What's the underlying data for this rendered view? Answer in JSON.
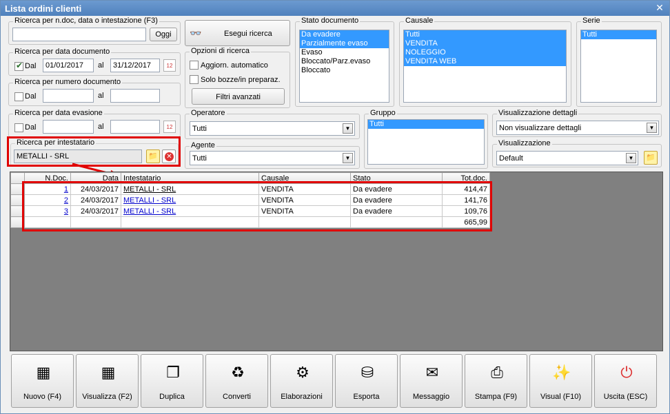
{
  "title": "Lista ordini clienti",
  "search_doc": {
    "label": "Ricerca per n.doc, data o intestazione (F3)",
    "value": "",
    "oggi": "Oggi"
  },
  "esegui": "Esegui ricerca",
  "data_doc": {
    "label": "Ricerca per data documento",
    "dal": "Dal",
    "from": "01/01/2017",
    "al": "al",
    "to": "31/12/2017",
    "checked": true
  },
  "num_doc": {
    "label": "Ricerca per numero documento",
    "dal": "Dal",
    "al": "al"
  },
  "opzioni": {
    "label": "Opzioni di ricerca",
    "aggiorn": "Aggiorn. automatico",
    "solo": "Solo bozze/in preparaz.",
    "filtri": "Filtri avanzati"
  },
  "stato": {
    "label": "Stato documento",
    "items": [
      "Da evadere",
      "Parzialmente evaso",
      "Evaso",
      "Bloccato/Parz.evaso",
      "Bloccato"
    ],
    "selected": [
      0,
      1
    ]
  },
  "causale": {
    "label": "Causale",
    "items": [
      "Tutti",
      "VENDITA",
      "NOLEGGIO",
      "VENDITA WEB"
    ],
    "selected": [
      0,
      1,
      2,
      3
    ]
  },
  "serie": {
    "label": "Serie",
    "items": [
      "Tutti"
    ],
    "selected": [
      0
    ]
  },
  "data_eva": {
    "label": "Ricerca per data evasione",
    "dal": "Dal",
    "al": "al"
  },
  "operatore": {
    "label": "Operatore",
    "value": "Tutti"
  },
  "gruppo": {
    "label": "Gruppo",
    "items": [
      "Tutti"
    ]
  },
  "vis_dettagli": {
    "label": "Visualizzazione dettagli",
    "value": "Non visualizzare dettagli"
  },
  "intestatario": {
    "label": "Ricerca per intestatario",
    "value": "METALLI - SRL"
  },
  "agente": {
    "label": "Agente",
    "value": "Tutti"
  },
  "visualizzazione": {
    "label": "Visualizzazione",
    "value": "Default"
  },
  "table": {
    "headers": [
      "N.Doc.",
      "Data",
      "Intestatario",
      "Causale",
      "Stato",
      "Tot.doc."
    ],
    "rows": [
      [
        "1",
        "24/03/2017",
        "METALLI - SRL",
        "VENDITA",
        "Da evadere",
        "414,47"
      ],
      [
        "2",
        "24/03/2017",
        "METALLI - SRL",
        "VENDITA",
        "Da evadere",
        "141,76"
      ],
      [
        "3",
        "24/03/2017",
        "METALLI - SRL",
        "VENDITA",
        "Da evadere",
        "109,76"
      ]
    ],
    "total": "665,99"
  },
  "toolbar": [
    "Nuovo (F4)",
    "Visualizza (F2)",
    "Duplica",
    "Converti",
    "Elaborazioni",
    "Esporta",
    "Messaggio",
    "Stampa (F9)",
    "Visual (F10)",
    "Uscita (ESC)"
  ],
  "colors": {
    "title": "#4f81bd",
    "selection": "#3399ff",
    "highlight": "#e00000"
  }
}
